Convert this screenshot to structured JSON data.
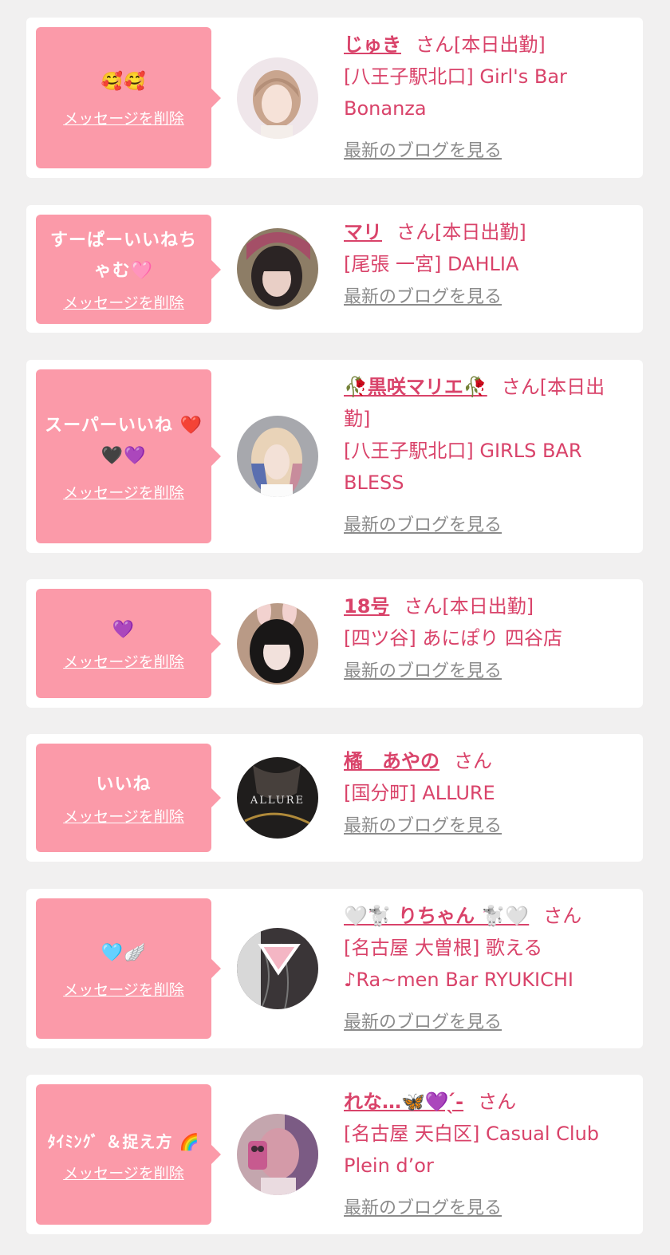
{
  "colors": {
    "background": "#f1f0f0",
    "bubble": "#fb9aa9",
    "accent": "#d9436a",
    "blog_link": "#8b8b8b"
  },
  "labels": {
    "delete_message": "メッセージを削除",
    "view_blog": "最新のブログを見る"
  },
  "items": [
    {
      "message": "🥰🥰",
      "name": "じゅき",
      "status": "さん[本日出勤]",
      "shop": "[八王子駅北口] Girl's Bar Bonanza",
      "avatar_icon": "girl-portrait-light"
    },
    {
      "message": "すーぱーいいねちゃむ🩷",
      "name": "マリ",
      "status": "さん[本日出勤]",
      "shop": "[尾張 一宮] DAHLIA",
      "avatar_icon": "girl-portrait-dark"
    },
    {
      "message": "スーパーいいね ❤️🖤💜",
      "name": "🥀黒咲マリエ🥀",
      "status": "さん[本日出勤]",
      "shop": "[八王子駅北口] GIRLS BAR BLESS",
      "avatar_icon": "girl-portrait-blonde"
    },
    {
      "message": "💜",
      "name": "18号",
      "status": "さん[本日出勤]",
      "shop": "[四ツ谷] あにぽり 四谷店",
      "avatar_icon": "girl-portrait-bunny"
    },
    {
      "message": "いいね",
      "name": "橘　あやの",
      "status": "さん",
      "shop": "[国分町] ALLURE",
      "avatar_icon": "allure-logo-dark"
    },
    {
      "message": "🩵🪽",
      "name": "🤍🐩 りちゃん 🐩🤍",
      "status": "さん",
      "shop": "[名古屋 大曽根] 歌える♪Ra~men Bar RYUKICHI",
      "avatar_icon": "triangle-photo-dark"
    },
    {
      "message": "ﾀｲﾐﾝｸﾞ ＆捉え方 🌈",
      "name": "れな…🦋💜 ̖́-",
      "status": "さん",
      "shop": "[名古屋 天白区] Casual Club Plein d’or",
      "avatar_icon": "girl-mirror-selfie"
    }
  ]
}
